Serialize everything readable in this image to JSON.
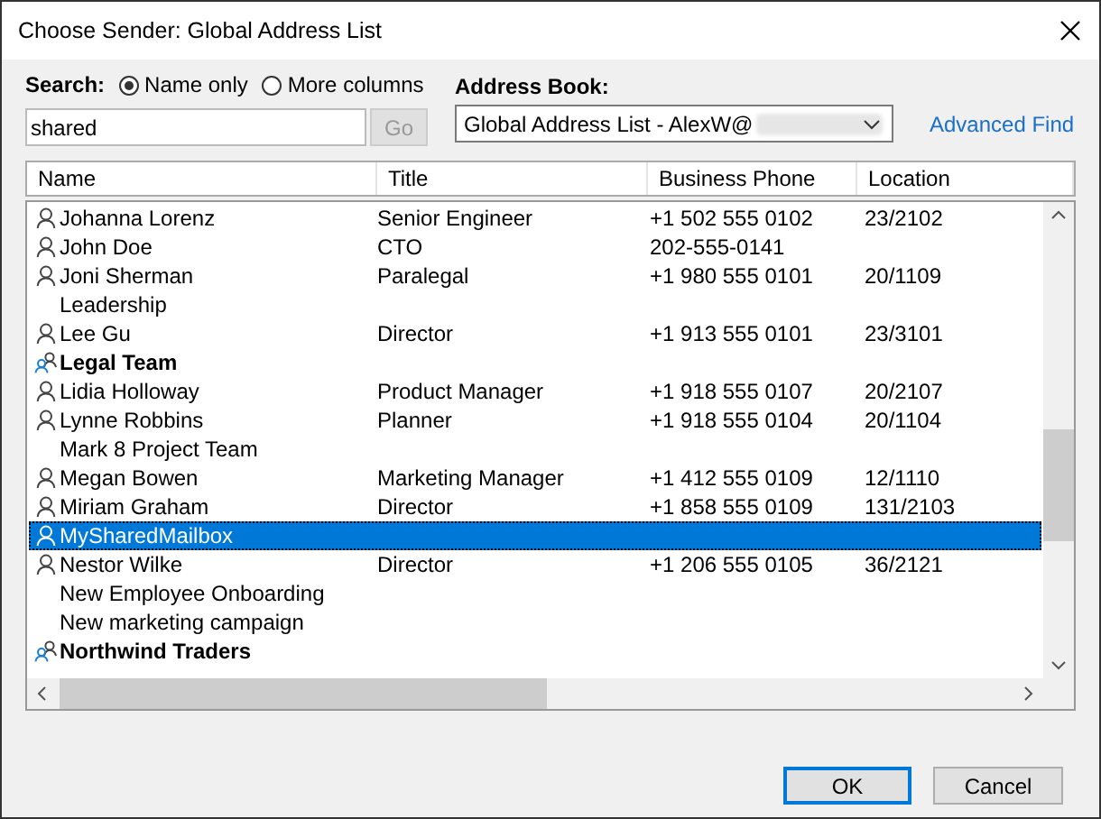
{
  "window": {
    "title": "Choose Sender: Global Address List"
  },
  "search": {
    "label": "Search:",
    "options": [
      {
        "label": "Name only",
        "selected": true
      },
      {
        "label": "More columns",
        "selected": false
      }
    ],
    "value": "shared",
    "go_button": {
      "label": "Go",
      "disabled": true
    }
  },
  "address_book": {
    "label": "Address Book:",
    "value": "Global Address List - AlexW@",
    "link": "Advanced Find"
  },
  "table": {
    "columns": [
      "Name",
      "Title",
      "Business Phone",
      "Location"
    ],
    "rows": [
      {
        "kind": "person",
        "name": "Johanna Lorenz",
        "title": "Senior Engineer",
        "phone": "+1 502 555 0102",
        "location": "23/2102",
        "selected": false
      },
      {
        "kind": "person",
        "name": "John Doe",
        "title": "CTO",
        "phone": "202-555-0141",
        "location": "",
        "selected": false
      },
      {
        "kind": "person",
        "name": "Joni Sherman",
        "title": "Paralegal",
        "phone": "+1 980 555 0101",
        "location": "20/1109",
        "selected": false
      },
      {
        "kind": "plain",
        "name": "Leadership",
        "title": "",
        "phone": "",
        "location": "",
        "selected": false
      },
      {
        "kind": "person",
        "name": "Lee Gu",
        "title": "Director",
        "phone": "+1 913 555 0101",
        "location": "23/3101",
        "selected": false
      },
      {
        "kind": "group",
        "name": "Legal Team",
        "title": "",
        "phone": "",
        "location": "",
        "selected": false
      },
      {
        "kind": "person",
        "name": "Lidia Holloway",
        "title": "Product Manager",
        "phone": "+1 918 555 0107",
        "location": "20/2107",
        "selected": false
      },
      {
        "kind": "person",
        "name": "Lynne Robbins",
        "title": "Planner",
        "phone": "+1 918 555 0104",
        "location": "20/1104",
        "selected": false
      },
      {
        "kind": "plain",
        "name": "Mark 8 Project Team",
        "title": "",
        "phone": "",
        "location": "",
        "selected": false
      },
      {
        "kind": "person",
        "name": "Megan Bowen",
        "title": "Marketing Manager",
        "phone": "+1 412 555 0109",
        "location": "12/1110",
        "selected": false
      },
      {
        "kind": "person",
        "name": "Miriam Graham",
        "title": "Director",
        "phone": "+1 858 555 0109",
        "location": "131/2103",
        "selected": false
      },
      {
        "kind": "person",
        "name": "MySharedMailbox",
        "title": "",
        "phone": "",
        "location": "",
        "selected": true
      },
      {
        "kind": "person",
        "name": "Nestor Wilke",
        "title": "Director",
        "phone": "+1 206 555 0105",
        "location": "36/2121",
        "selected": false
      },
      {
        "kind": "plain",
        "name": "New Employee Onboarding",
        "title": "",
        "phone": "",
        "location": "",
        "selected": false
      },
      {
        "kind": "plain",
        "name": "New marketing campaign",
        "title": "",
        "phone": "",
        "location": "",
        "selected": false
      },
      {
        "kind": "group",
        "name": "Northwind Traders",
        "title": "",
        "phone": "",
        "location": "",
        "selected": false
      }
    ]
  },
  "buttons": [
    {
      "label": "OK",
      "default": true
    },
    {
      "label": "Cancel",
      "default": false
    }
  ]
}
